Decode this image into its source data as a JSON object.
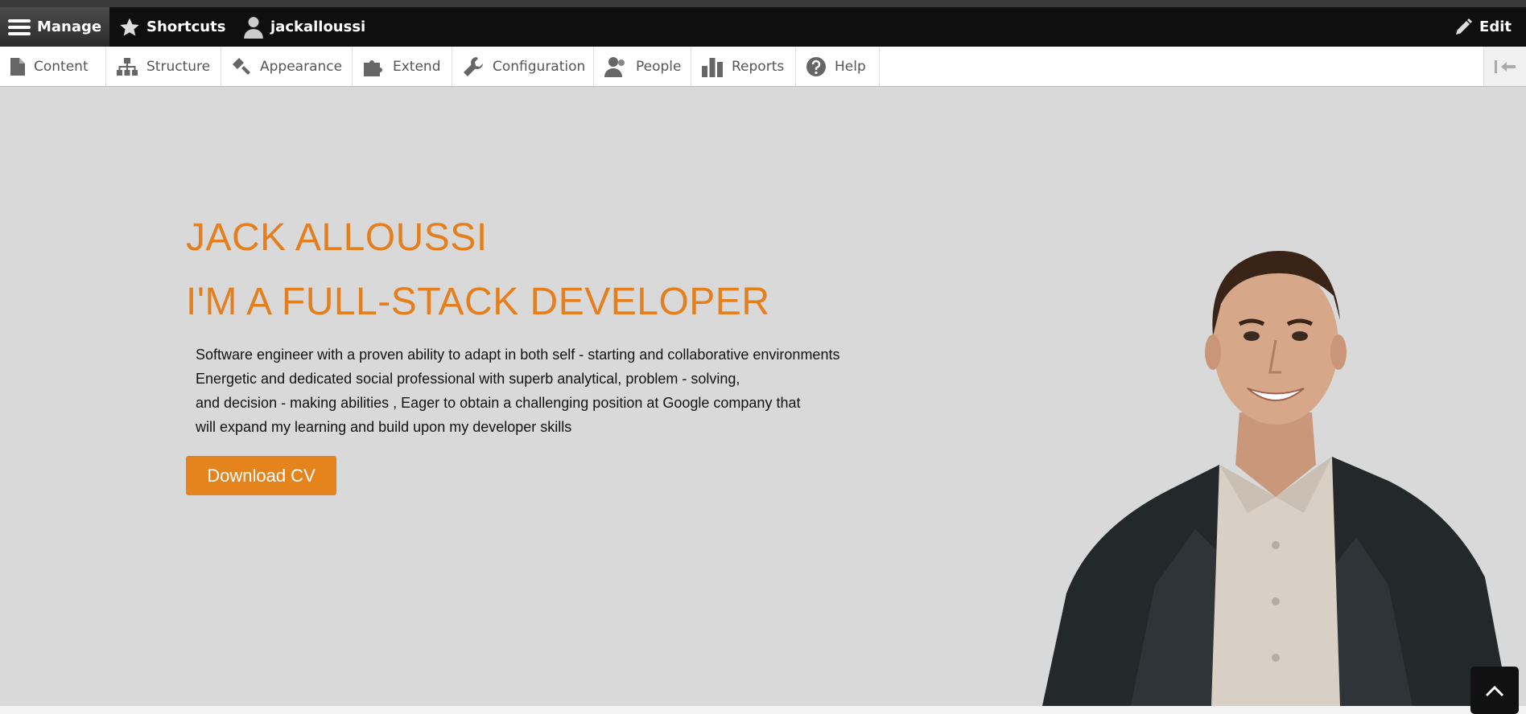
{
  "toolbar": {
    "manage_label": "Manage",
    "shortcuts_label": "Shortcuts",
    "user_label": "jackalloussi",
    "edit_label": "Edit"
  },
  "tray": {
    "items": [
      {
        "label": "Content",
        "icon": "file-icon"
      },
      {
        "label": "Structure",
        "icon": "sitemap-icon"
      },
      {
        "label": "Appearance",
        "icon": "paint-brush-icon"
      },
      {
        "label": "Extend",
        "icon": "puzzle-icon"
      },
      {
        "label": "Configuration",
        "icon": "wrench-icon"
      },
      {
        "label": "People",
        "icon": "people-icon"
      },
      {
        "label": "Reports",
        "icon": "bar-chart-icon"
      },
      {
        "label": "Help",
        "icon": "help-icon"
      }
    ]
  },
  "hero": {
    "name": "JACK ALLOUSSI",
    "role": "I'M A FULL-STACK DEVELOPER",
    "description": [
      "Software engineer with a proven ability to adapt in both self - starting and collaborative environments",
      "Energetic and dedicated social professional with superb analytical, problem - solving,",
      "and decision - making abilities , Eager to obtain a challenging position at Google company that",
      "will expand my learning and build upon my developer skills"
    ],
    "button_label": "Download CV"
  },
  "colors": {
    "accent": "#e5831c",
    "heading": "#e47f1e",
    "hero_bg": "#d9d9d9",
    "toolbar_bg": "#0f0f0f"
  }
}
